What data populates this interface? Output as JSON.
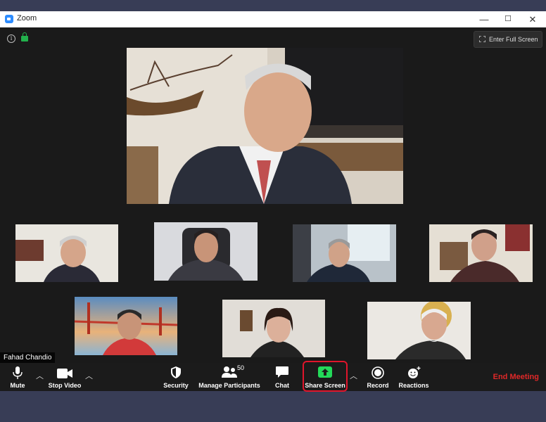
{
  "window": {
    "title": "Zoom",
    "controls": {
      "minimize": "—",
      "maximize": "☐",
      "close": "✕"
    }
  },
  "meeting": {
    "fullscreen_label": "Enter Full Screen",
    "active_speaker_name": "Fahad Chandio",
    "participant_count": "50"
  },
  "toolbar": {
    "mute": "Mute",
    "stop_video": "Stop Video",
    "security": "Security",
    "manage_participants": "Manage Participants",
    "chat": "Chat",
    "share_screen": "Share Screen",
    "record": "Record",
    "reactions": "Reactions",
    "end_meeting": "End Meeting"
  },
  "colors": {
    "share_green": "#23d959",
    "end_red": "#e02828",
    "highlight_red": "#e0152b",
    "secure_green": "#22b14c"
  },
  "icons": [
    "info-icon",
    "lock-icon",
    "fullscreen-icon",
    "microphone-icon",
    "video-camera-icon",
    "shield-icon",
    "participants-icon",
    "chat-bubble-icon",
    "share-screen-icon",
    "record-icon",
    "reactions-icon",
    "chevron-up-icon"
  ]
}
